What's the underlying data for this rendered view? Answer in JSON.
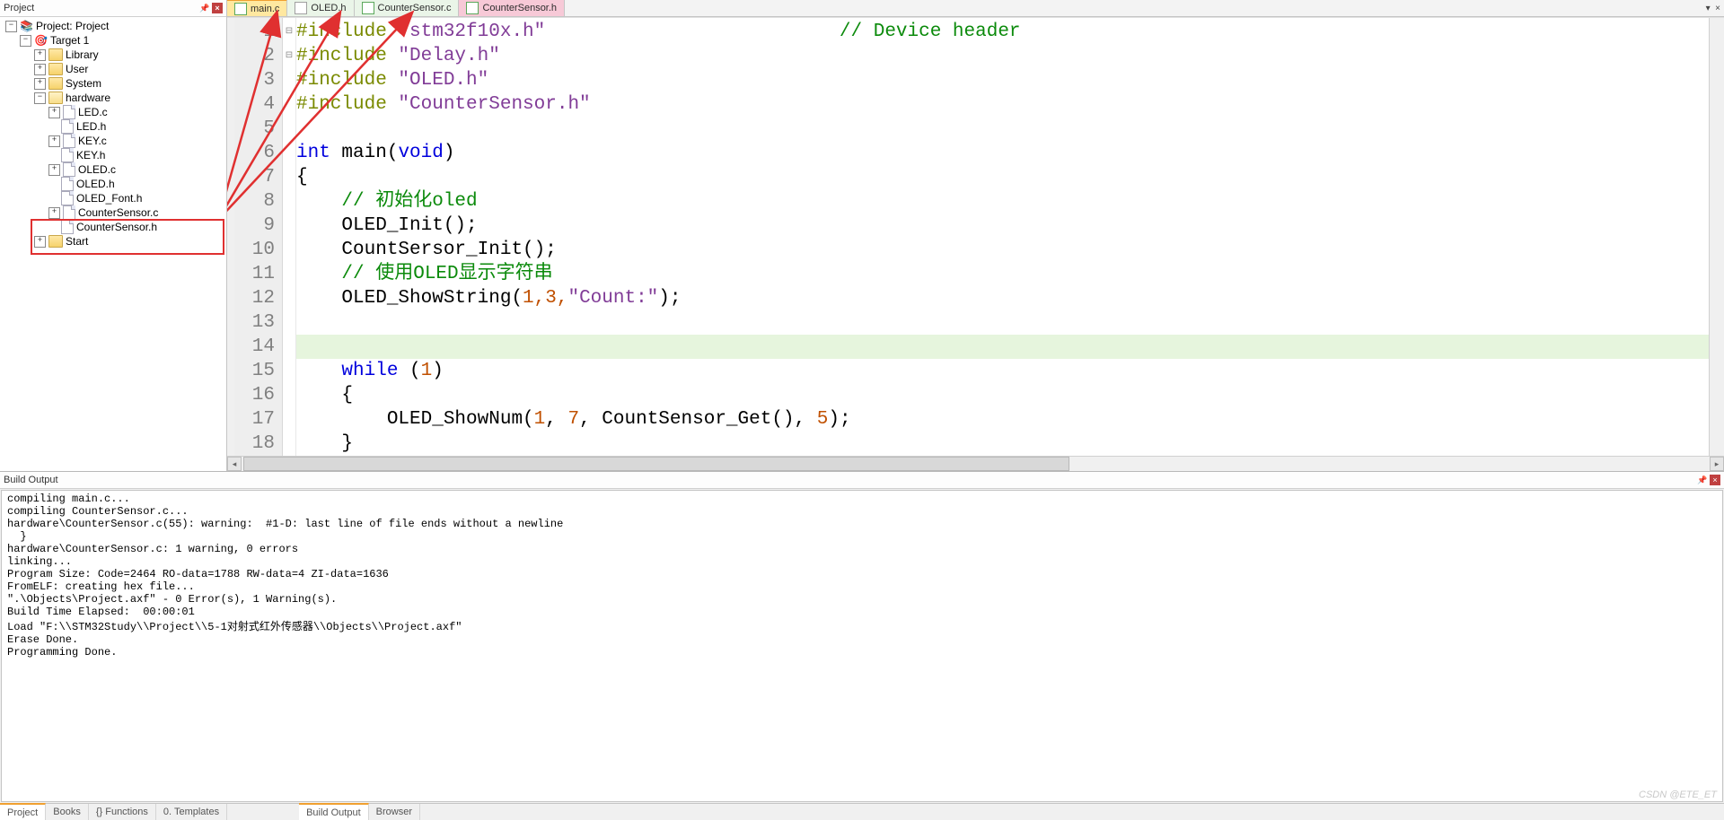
{
  "project_panel": {
    "title": "Project",
    "root": "Project: Project",
    "target": "Target 1",
    "folders": {
      "library": "Library",
      "user": "User",
      "system": "System",
      "hardware": "hardware",
      "start": "Start"
    },
    "hardware_files": [
      "LED.c",
      "LED.h",
      "KEY.c",
      "KEY.h",
      "OLED.c",
      "OLED.h",
      "OLED_Font.h",
      "CounterSensor.c",
      "CounterSensor.h"
    ]
  },
  "tabs": [
    {
      "name": "main.c",
      "active": true,
      "style": "c"
    },
    {
      "name": "OLED.h",
      "active": false,
      "style": "h"
    },
    {
      "name": "CounterSensor.c",
      "active": false,
      "style": "c"
    },
    {
      "name": "CounterSensor.h",
      "active": false,
      "style": "pink"
    }
  ],
  "code": {
    "lines": [
      {
        "n": 1,
        "type": "inc",
        "t": "#include ",
        "s": "\"stm32f10x.h\"",
        "tail_comment": "// Device header"
      },
      {
        "n": 2,
        "type": "inc",
        "t": "#include ",
        "s": "\"Delay.h\""
      },
      {
        "n": 3,
        "type": "inc",
        "t": "#include ",
        "s": "\"OLED.h\""
      },
      {
        "n": 4,
        "type": "inc",
        "t": "#include ",
        "s": "\"CounterSensor.h\""
      },
      {
        "n": 5,
        "type": "blank"
      },
      {
        "n": 6,
        "type": "func",
        "text": "int main(void)"
      },
      {
        "n": 7,
        "type": "plain",
        "text": "{",
        "fold": "⊟"
      },
      {
        "n": 8,
        "type": "comment",
        "text": "    // 初始化oled"
      },
      {
        "n": 9,
        "type": "plain",
        "text": "    OLED_Init();"
      },
      {
        "n": 10,
        "type": "plain",
        "text": "    CountSersor_Init();"
      },
      {
        "n": 11,
        "type": "comment",
        "text": "    // 使用OLED显示字符串"
      },
      {
        "n": 12,
        "type": "call_str",
        "pre": "    OLED_ShowString(",
        "args": "1,3,",
        "str": "\"Count:\"",
        "post": ");"
      },
      {
        "n": 13,
        "type": "blank"
      },
      {
        "n": 14,
        "type": "blank",
        "hl": true
      },
      {
        "n": 15,
        "type": "while",
        "text": "    while (1)"
      },
      {
        "n": 16,
        "type": "plain",
        "text": "    {",
        "fold": "⊟"
      },
      {
        "n": 17,
        "type": "call_num",
        "pre": "        OLED_ShowNum(",
        "args": [
          "1",
          "7"
        ],
        "mid": ", CountSensor_Get(), ",
        "last": "5",
        "post": ");"
      },
      {
        "n": 18,
        "type": "plain",
        "text": "    }"
      }
    ]
  },
  "build": {
    "title": "Build Output",
    "lines": [
      "compiling main.c...",
      "compiling CounterSensor.c...",
      "hardware\\CounterSensor.c(55): warning:  #1-D: last line of file ends without a newline",
      "  }",
      "hardware\\CounterSensor.c: 1 warning, 0 errors",
      "linking...",
      "Program Size: Code=2464 RO-data=1788 RW-data=4 ZI-data=1636",
      "FromELF: creating hex file...",
      "\".\\Objects\\Project.axf\" - 0 Error(s), 1 Warning(s).",
      "Build Time Elapsed:  00:00:01",
      "Load \"F:\\\\STM32Study\\\\Project\\\\5-1对射式红外传感器\\\\Objects\\\\Project.axf\"",
      "Erase Done.",
      "Programming Done."
    ]
  },
  "bottom_tabs_left": [
    "Project",
    "Books",
    "{} Functions",
    "0. Templates"
  ],
  "bottom_tabs_right": [
    "Build Output",
    "Browser"
  ],
  "watermark": "CSDN @ETE_ET"
}
